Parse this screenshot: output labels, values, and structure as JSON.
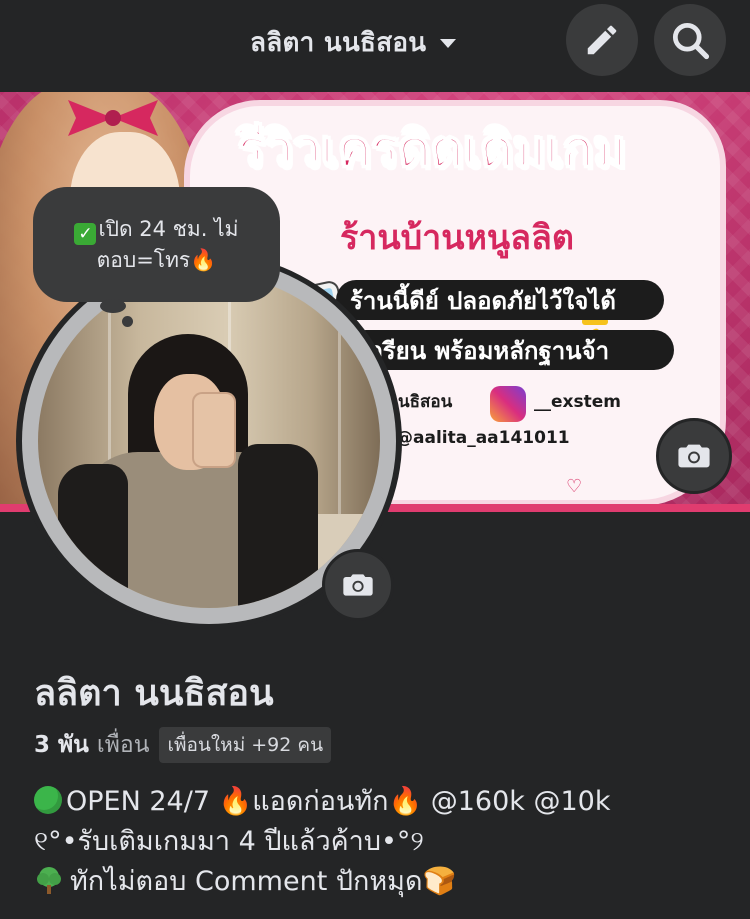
{
  "header": {
    "title": "ลลิตา นนธิสอน",
    "edit_icon": "pencil-icon",
    "search_icon": "search-icon"
  },
  "cover": {
    "heading": "รีวิวเครดิตเติมเกม",
    "subheading": "ร้านบ้านหนูลลิต",
    "line1": "ร้านนี้ดีย์ ปลอดภัยไว้ใจได้",
    "line2": "เกรียน พร้อมหลักฐานจ้า",
    "handle_name": "นธิสอน",
    "instagram": "__exstem",
    "handle_small": "@aalita_aa141011",
    "camera_icon": "camera-icon"
  },
  "status_bubble": {
    "line1": "เปิด 24 ชม. ไม่",
    "line2": "ตอบ=โทร🔥"
  },
  "profile": {
    "name": "ลลิตา นนธิสอน",
    "friends_count": "3 พัน",
    "friends_label": "เพื่อน",
    "new_friends": "เพื่อนใหม่ +92 คน",
    "camera_icon": "camera-icon"
  },
  "bio": {
    "line1": "OPEN 24/7 🔥แอดก่อนทัก🔥 @160k @10k",
    "line2": "୧°•รับเติมเกมมา 4 ปีแล้วค้าบ•°୨",
    "line3": "ทักไม่ตอบ Comment ปักหมุด🍞"
  },
  "colors": {
    "background": "#242526",
    "button": "#3a3b3c",
    "text": "#e4e6eb",
    "muted": "#b0b3b8",
    "cover_accent": "#d6285f"
  }
}
